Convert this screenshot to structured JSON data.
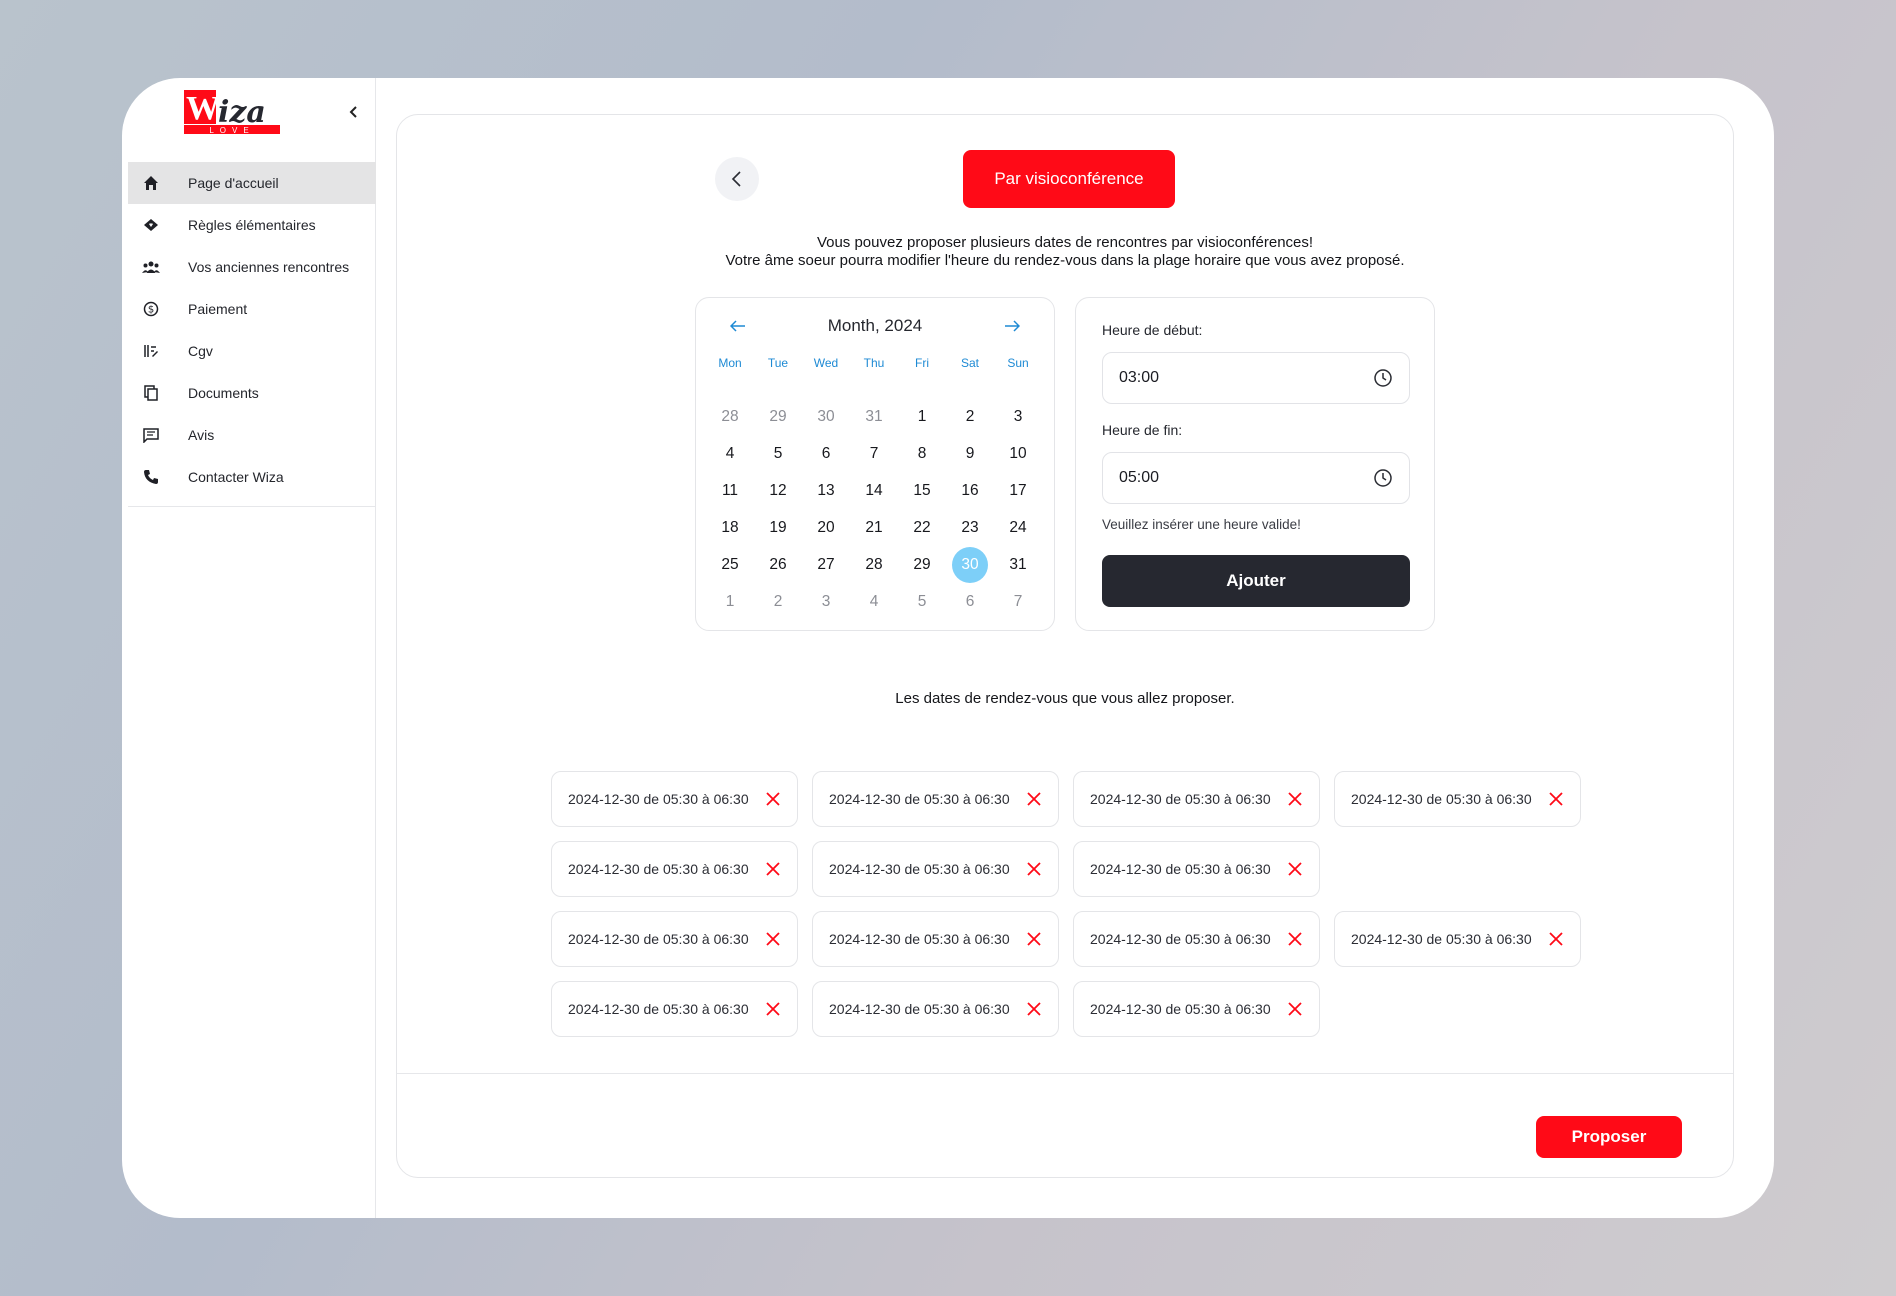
{
  "brand": {
    "logo_text": "Wiza",
    "logo_sub": "LOVE",
    "red": "#ff0a17",
    "dark": "#262830",
    "accent_blue": "#1e8ad4",
    "selected_day": "#7dcff8"
  },
  "sidebar": {
    "items": [
      {
        "label": "Page d'accueil",
        "icon": "home-icon",
        "active": true
      },
      {
        "label": "Règles élémentaires",
        "icon": "diamond-heart-icon"
      },
      {
        "label": "Vos anciennes rencontres",
        "icon": "users-icon"
      },
      {
        "label": "Paiement",
        "icon": "dollar-circle-icon"
      },
      {
        "label": "Cgv",
        "icon": "terms-icon"
      },
      {
        "label": "Documents",
        "icon": "documents-icon"
      },
      {
        "label": "Avis",
        "icon": "message-icon"
      },
      {
        "label": "Contacter Wiza",
        "icon": "phone-icon"
      }
    ]
  },
  "main": {
    "mode_button": "Par visioconférence",
    "intro_line1": "Vous pouvez proposer plusieurs dates de rencontres par visioconférences!",
    "intro_line2": "Votre âme soeur pourra modifier l'heure du rendez-vous dans la plage horaire que vous avez proposé.",
    "calendar": {
      "title": "Month, 2024",
      "weekdays": [
        "Mon",
        "Tue",
        "Wed",
        "Thu",
        "Fri",
        "Sat",
        "Sun"
      ],
      "days": [
        {
          "d": "28",
          "m": true
        },
        {
          "d": "29",
          "m": true
        },
        {
          "d": "30",
          "m": true
        },
        {
          "d": "31",
          "m": true
        },
        {
          "d": "1"
        },
        {
          "d": "2"
        },
        {
          "d": "3"
        },
        {
          "d": "4"
        },
        {
          "d": "5"
        },
        {
          "d": "6"
        },
        {
          "d": "7"
        },
        {
          "d": "8"
        },
        {
          "d": "9"
        },
        {
          "d": "10"
        },
        {
          "d": "11"
        },
        {
          "d": "12"
        },
        {
          "d": "13"
        },
        {
          "d": "14"
        },
        {
          "d": "15"
        },
        {
          "d": "16"
        },
        {
          "d": "17"
        },
        {
          "d": "18"
        },
        {
          "d": "19"
        },
        {
          "d": "20"
        },
        {
          "d": "21"
        },
        {
          "d": "22"
        },
        {
          "d": "23"
        },
        {
          "d": "24"
        },
        {
          "d": "25"
        },
        {
          "d": "26"
        },
        {
          "d": "27"
        },
        {
          "d": "28"
        },
        {
          "d": "29"
        },
        {
          "d": "30",
          "sel": true
        },
        {
          "d": "31"
        },
        {
          "d": "1",
          "m": true
        },
        {
          "d": "2",
          "m": true
        },
        {
          "d": "3",
          "m": true
        },
        {
          "d": "4",
          "m": true
        },
        {
          "d": "5",
          "m": true
        },
        {
          "d": "6",
          "m": true
        },
        {
          "d": "7",
          "m": true
        }
      ]
    },
    "time": {
      "start_label": "Heure de début:",
      "start_value": "03:00",
      "end_label": "Heure de fin:",
      "end_value": "05:00",
      "hint": "Veuillez insérer une heure valide!",
      "add_button": "Ajouter"
    },
    "list_title": "Les dates de rendez-vous que vous allez proposer.",
    "slot_rows": [
      [
        "2024-12-30 de 05:30 à 06:30",
        "2024-12-30 de 05:30 à 06:30",
        "2024-12-30 de 05:30 à 06:30",
        "2024-12-30 de 05:30 à 06:30"
      ],
      [
        "2024-12-30 de 05:30 à 06:30",
        "2024-12-30 de 05:30 à 06:30",
        "2024-12-30 de 05:30 à 06:30"
      ],
      [
        "2024-12-30 de 05:30 à 06:30",
        "2024-12-30 de 05:30 à 06:30",
        "2024-12-30 de 05:30 à 06:30",
        "2024-12-30 de 05:30 à 06:30"
      ],
      [
        "2024-12-30 de 05:30 à 06:30",
        "2024-12-30 de 05:30 à 06:30",
        "2024-12-30 de 05:30 à 06:30"
      ]
    ],
    "propose_button": "Proposer"
  }
}
